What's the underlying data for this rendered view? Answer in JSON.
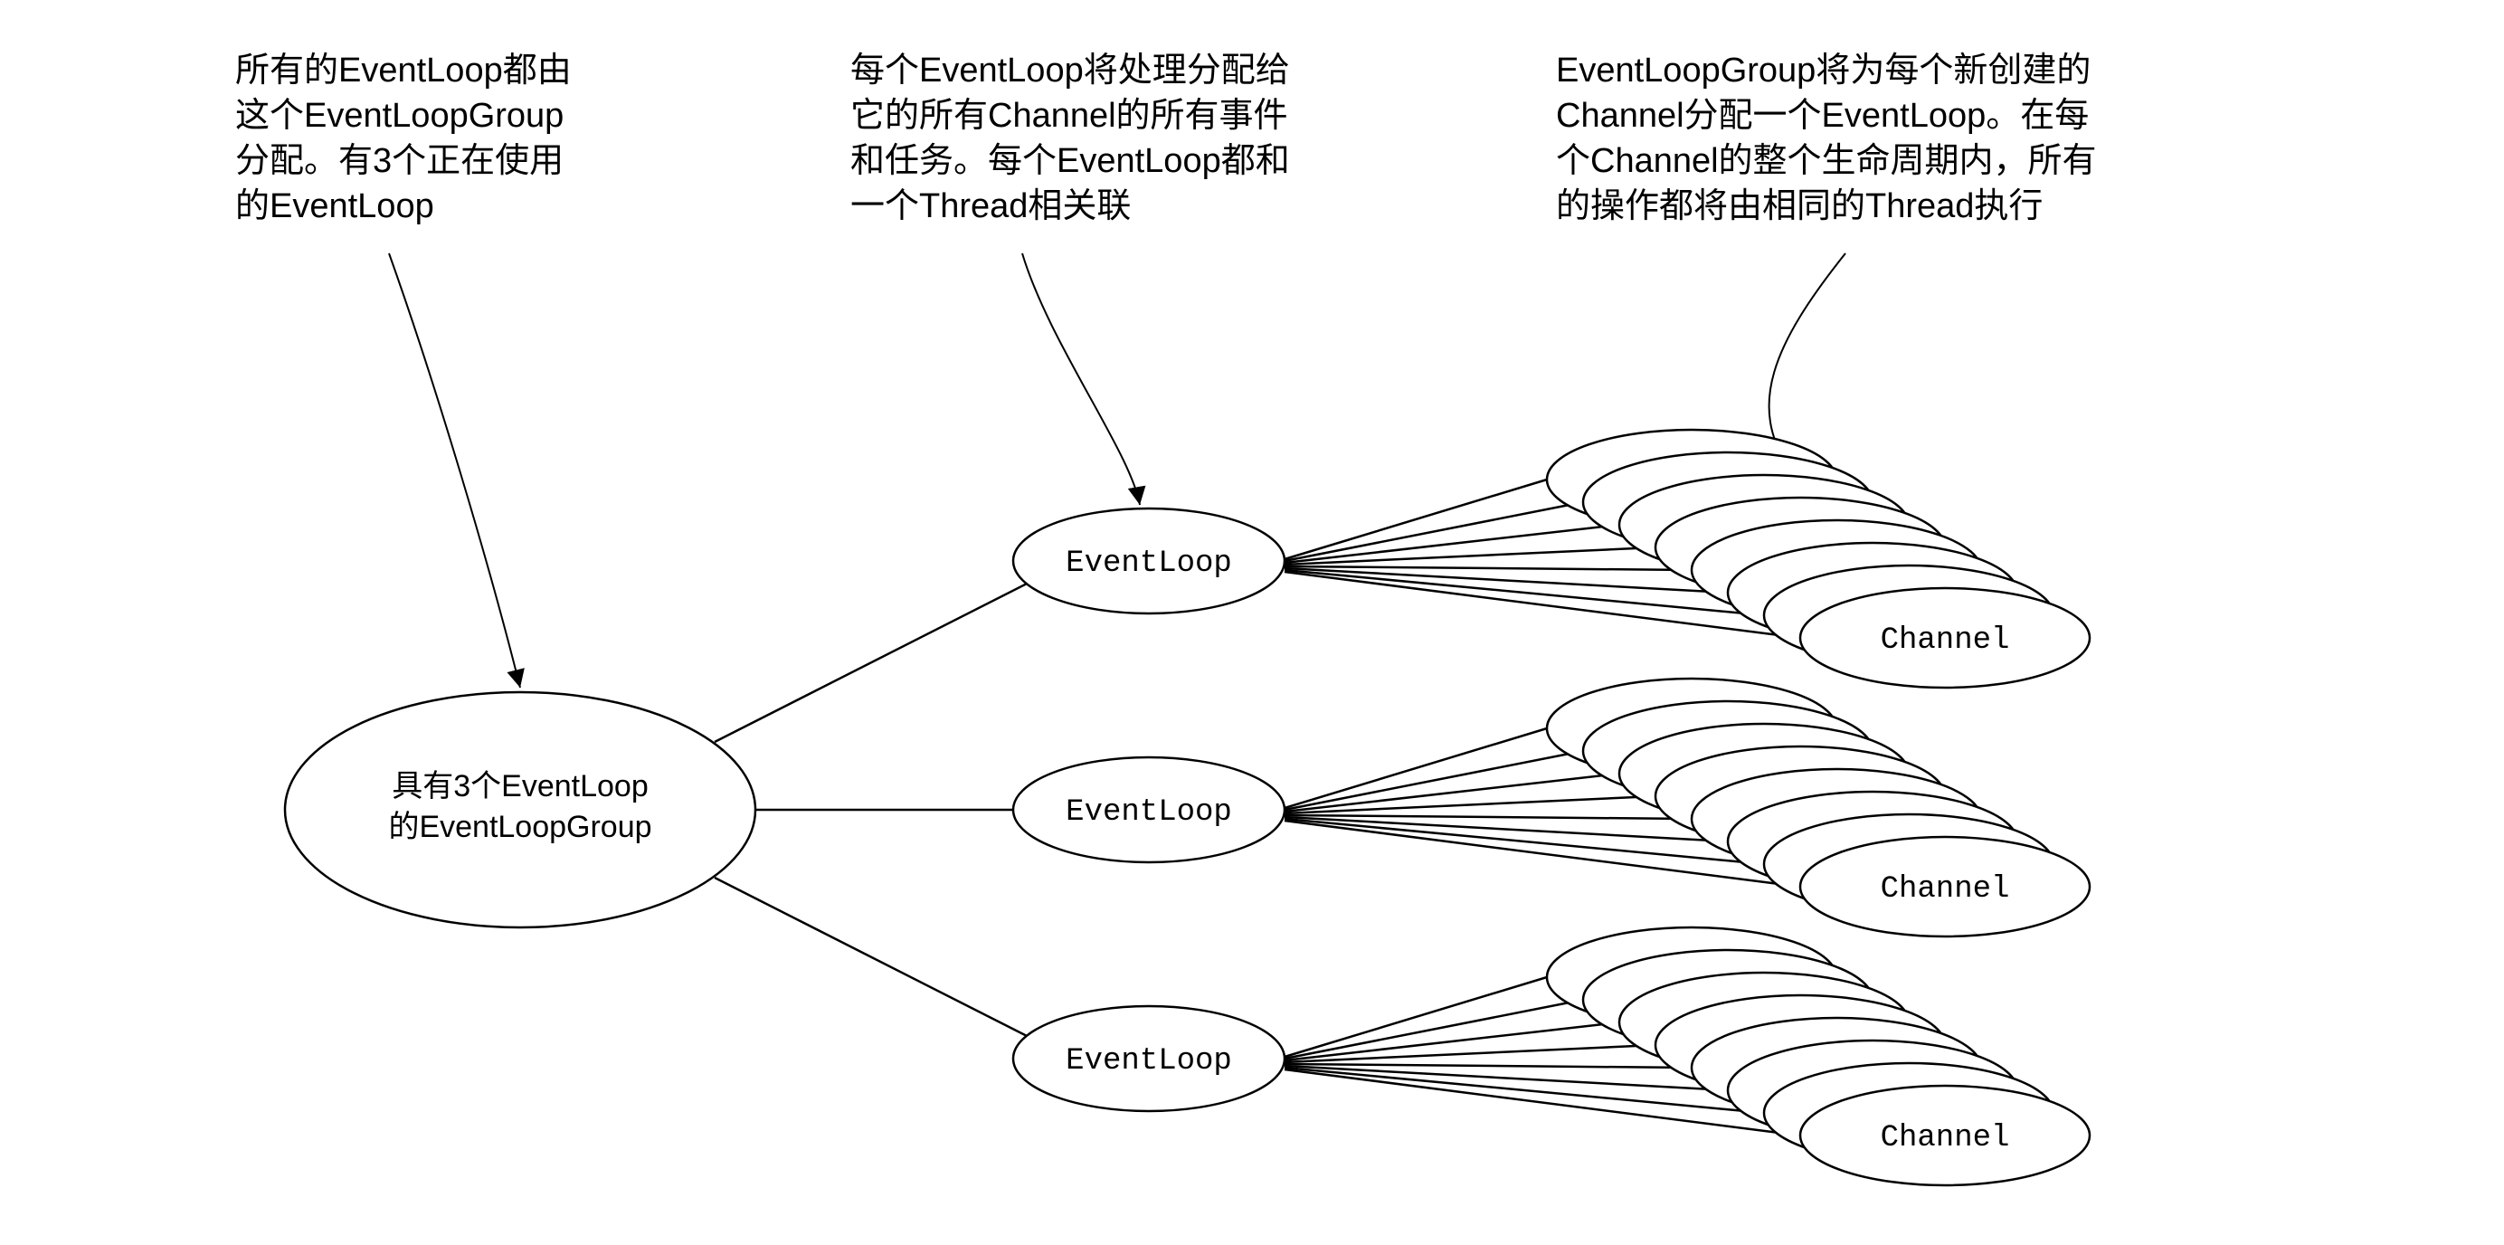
{
  "annotations": {
    "left": {
      "l1": "所有的EventLoop都由",
      "l2": "这个EventLoopGroup",
      "l3": "分配。有3个正在使用",
      "l4": "的EventLoop"
    },
    "middle": {
      "l1": "每个EventLoop将处理分配给",
      "l2": "它的所有Channel的所有事件",
      "l3": "和任务。每个EventLoop都和",
      "l4": "一个Thread相关联"
    },
    "right": {
      "l1": "EventLoopGroup将为每个新创建的",
      "l2": "Channel分配一个EventLoop。在每",
      "l3": "个Channel的整个生命周期内，所有",
      "l4": "的操作都将由相同的Thread执行"
    }
  },
  "nodes": {
    "group_line1": "具有3个EventLoop",
    "group_line2": "的EventLoopGroup",
    "eventloop": "EventLoop",
    "channel": "Channel"
  }
}
